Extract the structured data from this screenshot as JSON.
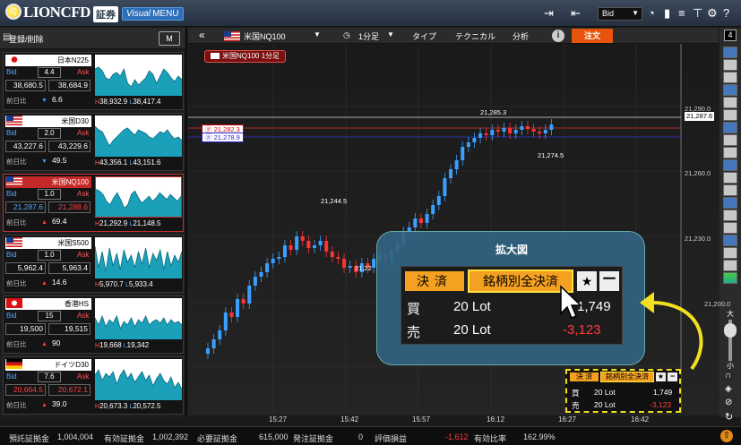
{
  "header": {
    "logo": "LIONCFD",
    "logo_badge": "証券",
    "visual_menu_prefix": "Visual",
    "visual_menu_label": "MENU",
    "price_type": "Bid"
  },
  "left_panel": {
    "register_label": "登録/削除",
    "size_label": "M",
    "cards": [
      {
        "name": "日本N225",
        "flag": "jp",
        "spread": "4.4",
        "bid": "38,680.5",
        "ask": "38,684.9",
        "change_label": "前日比",
        "direction": "down",
        "change": "6.6",
        "high": "38,932.9",
        "low": "38,417.4",
        "mini": [
          30,
          32,
          28,
          20,
          18,
          24,
          26,
          22,
          30,
          14,
          10,
          18,
          12,
          16,
          20,
          28,
          24,
          14,
          22,
          30,
          26,
          20,
          16,
          22,
          18
        ]
      },
      {
        "name": "米国D30",
        "flag": "us",
        "spread": "2.0",
        "bid": "43,227.6",
        "ask": "43,229.6",
        "change_label": "前日比",
        "direction": "down",
        "change": "49.5",
        "high": "43,356.1",
        "low": "43,151.6",
        "mini": [
          34,
          30,
          28,
          20,
          12,
          18,
          22,
          26,
          30,
          32,
          28,
          24,
          30,
          28,
          26,
          22,
          20,
          24,
          28,
          26,
          30,
          24,
          20,
          22,
          18
        ]
      },
      {
        "name": "米国NQ100",
        "flag": "us",
        "spread": "1.0",
        "bid": "21,287.6",
        "ask": "21,288.6",
        "change_label": "前日比",
        "direction": "up",
        "change": "69.4",
        "high": "21,292.9",
        "low": "21,148.5",
        "mini": [
          32,
          30,
          26,
          18,
          14,
          22,
          28,
          20,
          10,
          14,
          26,
          30,
          22,
          16,
          20,
          24,
          18,
          22,
          28,
          24,
          20,
          26,
          22,
          18,
          24
        ]
      },
      {
        "name": "米国S500",
        "flag": "us",
        "spread": "1.0",
        "bid": "5,962.4",
        "ask": "5,963.4",
        "change_label": "前日比",
        "direction": "up",
        "change": "14.6",
        "high": "5,970.7",
        "low": "5,933.4",
        "mini": [
          36,
          12,
          30,
          8,
          34,
          14,
          28,
          10,
          32,
          18,
          26,
          12,
          30,
          16,
          34,
          12,
          28,
          20,
          32,
          10,
          30,
          14,
          26,
          18,
          30
        ]
      },
      {
        "name": "香港HS",
        "flag": "hk",
        "spread": "15",
        "bid": "19,500",
        "ask": "19,515",
        "change_label": "前日比",
        "direction": "up",
        "change": "90",
        "high": "19,668",
        "low": "19,342",
        "mini": [
          24,
          16,
          26,
          14,
          22,
          18,
          26,
          12,
          20,
          16,
          24,
          14,
          22,
          18,
          26,
          16,
          20,
          22,
          18,
          24,
          16,
          22,
          18,
          20,
          16
        ]
      },
      {
        "name": "ドイツD30",
        "flag": "de",
        "spread": "7.6",
        "bid": "20,664.5",
        "ask": "20,672.1",
        "change_label": "前日比",
        "direction": "up",
        "change": "39.0",
        "high": "20,673.3",
        "low": "20,572.5",
        "mini": [
          28,
          34,
          22,
          30,
          26,
          32,
          18,
          28,
          34,
          24,
          30,
          20,
          26,
          32,
          22,
          28,
          16,
          24,
          30,
          22,
          18,
          26,
          14,
          20,
          12
        ]
      }
    ]
  },
  "toolbar": {
    "symbol": "米国NQ100",
    "interval": "1分足",
    "type_label": "タイプ",
    "technical_label": "テクニカル",
    "analysis_label": "分析",
    "info_label": "i",
    "order_label": "注文",
    "panel_count": "4"
  },
  "chart": {
    "tag": "米国NQ100 1分足",
    "ask_line": "21,282.3",
    "bid_line": "21,278.9",
    "current": "21,287.6",
    "annotations": [
      "21,285.3",
      "21,274.5",
      "21,244.5",
      "21,22"
    ],
    "y_ticks": [
      "21,290.0",
      "21,260.0",
      "21,230.0",
      "21,200.0"
    ],
    "x_ticks": [
      "15:27",
      "15:42",
      "15:57",
      "16:12",
      "16:27",
      "16:42"
    ],
    "zoom_label_top": "大",
    "zoom_label_bottom": "小"
  },
  "chart_data": {
    "type": "candlestick",
    "series": "米国NQ100 1分足",
    "y_ticks": [
      21290.0,
      21260.0,
      21230.0,
      21200.0
    ],
    "x_ticks": [
      "15:27",
      "15:42",
      "15:57",
      "16:12",
      "16:27",
      "16:42"
    ],
    "annotations": [
      21285.3,
      21274.5,
      21244.5
    ],
    "current_price": 21287.6
  },
  "zoom": {
    "title": "拡大図",
    "settle_label": "決済",
    "settle_by_symbol_label": "銘柄別全決済",
    "star": "★",
    "minus": "ー",
    "buy_label": "買",
    "buy_lot": "20 Lot",
    "buy_pl": "1,749",
    "sell_label": "売",
    "sell_lot": "20 Lot",
    "sell_pl": "-3,123"
  },
  "mini_panel": {
    "settle_label": "決 済",
    "settle_by_symbol_label": "銘柄別全決済",
    "buy_label": "買",
    "buy_lot": "20 Lot",
    "buy_pl": "1,749",
    "sell_label": "売",
    "sell_lot": "20 Lot",
    "sell_pl": "-3,123"
  },
  "footer": {
    "deposit_label": "預託証拠金",
    "deposit": "1,004,004",
    "effective_label": "有効証拠金",
    "effective": "1,002,392",
    "required_label": "必要証拠金",
    "required": "615,000",
    "order_margin_label": "発注証拠金",
    "order_margin": "0",
    "pl_label": "評価損益",
    "pl": "-1,612",
    "ratio_label": "有効比率",
    "ratio": "162.99%"
  },
  "colors": {
    "accent": "#e8540c",
    "bid": "#3a9dff",
    "ask": "#ff3b3b",
    "highlight": "#f0e020"
  }
}
